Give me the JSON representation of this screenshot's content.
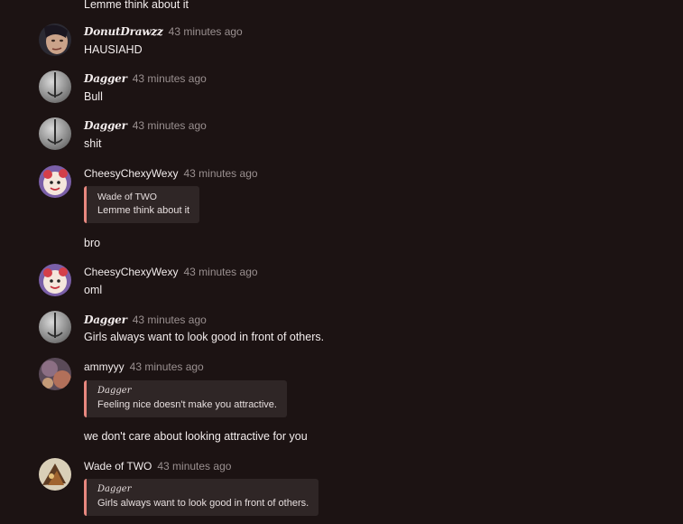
{
  "messages": [
    {
      "text": "Lemme think about it"
    },
    {
      "author": "DonutDrawzz",
      "time": "43 minutes ago",
      "text": "HAUSIAHD",
      "avatar": "donut-avatar"
    },
    {
      "author": "Dagger",
      "time": "43 minutes ago",
      "text": "Bull",
      "avatar": "sword-avatar"
    },
    {
      "author": "Dagger",
      "time": "43 minutes ago",
      "text": "shit",
      "avatar": "sword-avatar"
    },
    {
      "author": "CheesyChexyWexy",
      "time": "43 minutes ago",
      "quote_author": "Wade of TWO",
      "quote_text": "Lemme think about it",
      "text": "bro",
      "avatar": "cheesy-avatar"
    },
    {
      "author": "CheesyChexyWexy",
      "time": "43 minutes ago",
      "text": "oml",
      "avatar": "cheesy-avatar"
    },
    {
      "author": "Dagger",
      "time": "43 minutes ago",
      "text": "Girls always want to look good in front of others.",
      "avatar": "sword-avatar"
    },
    {
      "author": "ammyyy",
      "time": "43 minutes ago",
      "quote_author": "Dagger",
      "quote_text": "Feeling nice doesn't make you attractive.",
      "text": "we don't care about looking attractive for you",
      "avatar": "ammy-avatar"
    },
    {
      "author": "Wade of TWO",
      "time": "43 minutes ago",
      "quote_author": "Dagger",
      "quote_text": "Girls always want to look good in front of others.",
      "avatar": "wade-avatar"
    }
  ],
  "colors": {
    "background": "#1c1313",
    "quote_accent": "#e7877f",
    "quote_bg": "#2f2626",
    "muted": "#9a9090"
  }
}
